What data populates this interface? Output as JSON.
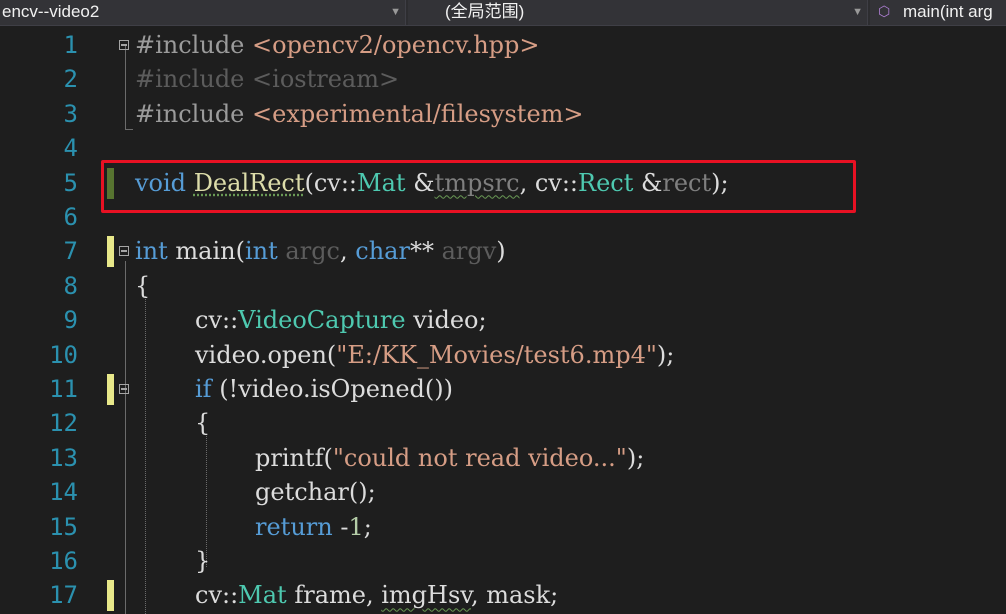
{
  "navigation_bar": {
    "project": "encv--video2",
    "scope": "(全局范围)",
    "member": "main(int arg",
    "member_icon": "cube-icon",
    "dropdown_icon": "chevron-down-icon"
  },
  "editor": {
    "line_numbers": [
      "1",
      "2",
      "3",
      "4",
      "5",
      "6",
      "7",
      "8",
      "9",
      "10",
      "11",
      "12",
      "13",
      "14",
      "15",
      "16",
      "17"
    ],
    "lines": {
      "l1": [
        "#include",
        " ",
        "<opencv2/opencv.hpp>"
      ],
      "l2": [
        "#include",
        " ",
        "<iostream>"
      ],
      "l3": [
        "#include",
        " ",
        "<experimental/filesystem>"
      ],
      "l5": [
        "void",
        " ",
        "DealRect",
        "(cv::",
        "Mat",
        " &",
        "tmpsrc",
        ", cv::",
        "Rect",
        " &",
        "rect",
        ");"
      ],
      "l7": [
        "int",
        " main(",
        "int",
        " ",
        "argc",
        ", ",
        "char",
        "** ",
        "argv",
        ")"
      ],
      "l8": [
        "{"
      ],
      "l9": [
        "cv::",
        "VideoCapture",
        " video;"
      ],
      "l10": [
        "video.open(",
        "\"E:/KK_Movies/test6.mp4\"",
        ");"
      ],
      "l11": [
        "if",
        " (!video.isOpened())"
      ],
      "l12": [
        "{"
      ],
      "l13": [
        "printf(",
        "\"could not read video...\"",
        ");"
      ],
      "l14": [
        "getchar",
        "();"
      ],
      "l15": [
        "return",
        " -",
        "1",
        ";"
      ],
      "l16": [
        "}"
      ],
      "l17": [
        "cv::",
        "Mat",
        " frame, ",
        "imgHsv",
        ", mask;"
      ]
    }
  },
  "colors": {
    "background": "#1e1e1e",
    "keyword": "#569cd6",
    "type": "#4ec9b0",
    "string": "#d69d85",
    "line_number": "#2b91af",
    "highlight_box": "#e81123",
    "change_unsaved": "#e8e88a",
    "change_saved": "#577430"
  }
}
